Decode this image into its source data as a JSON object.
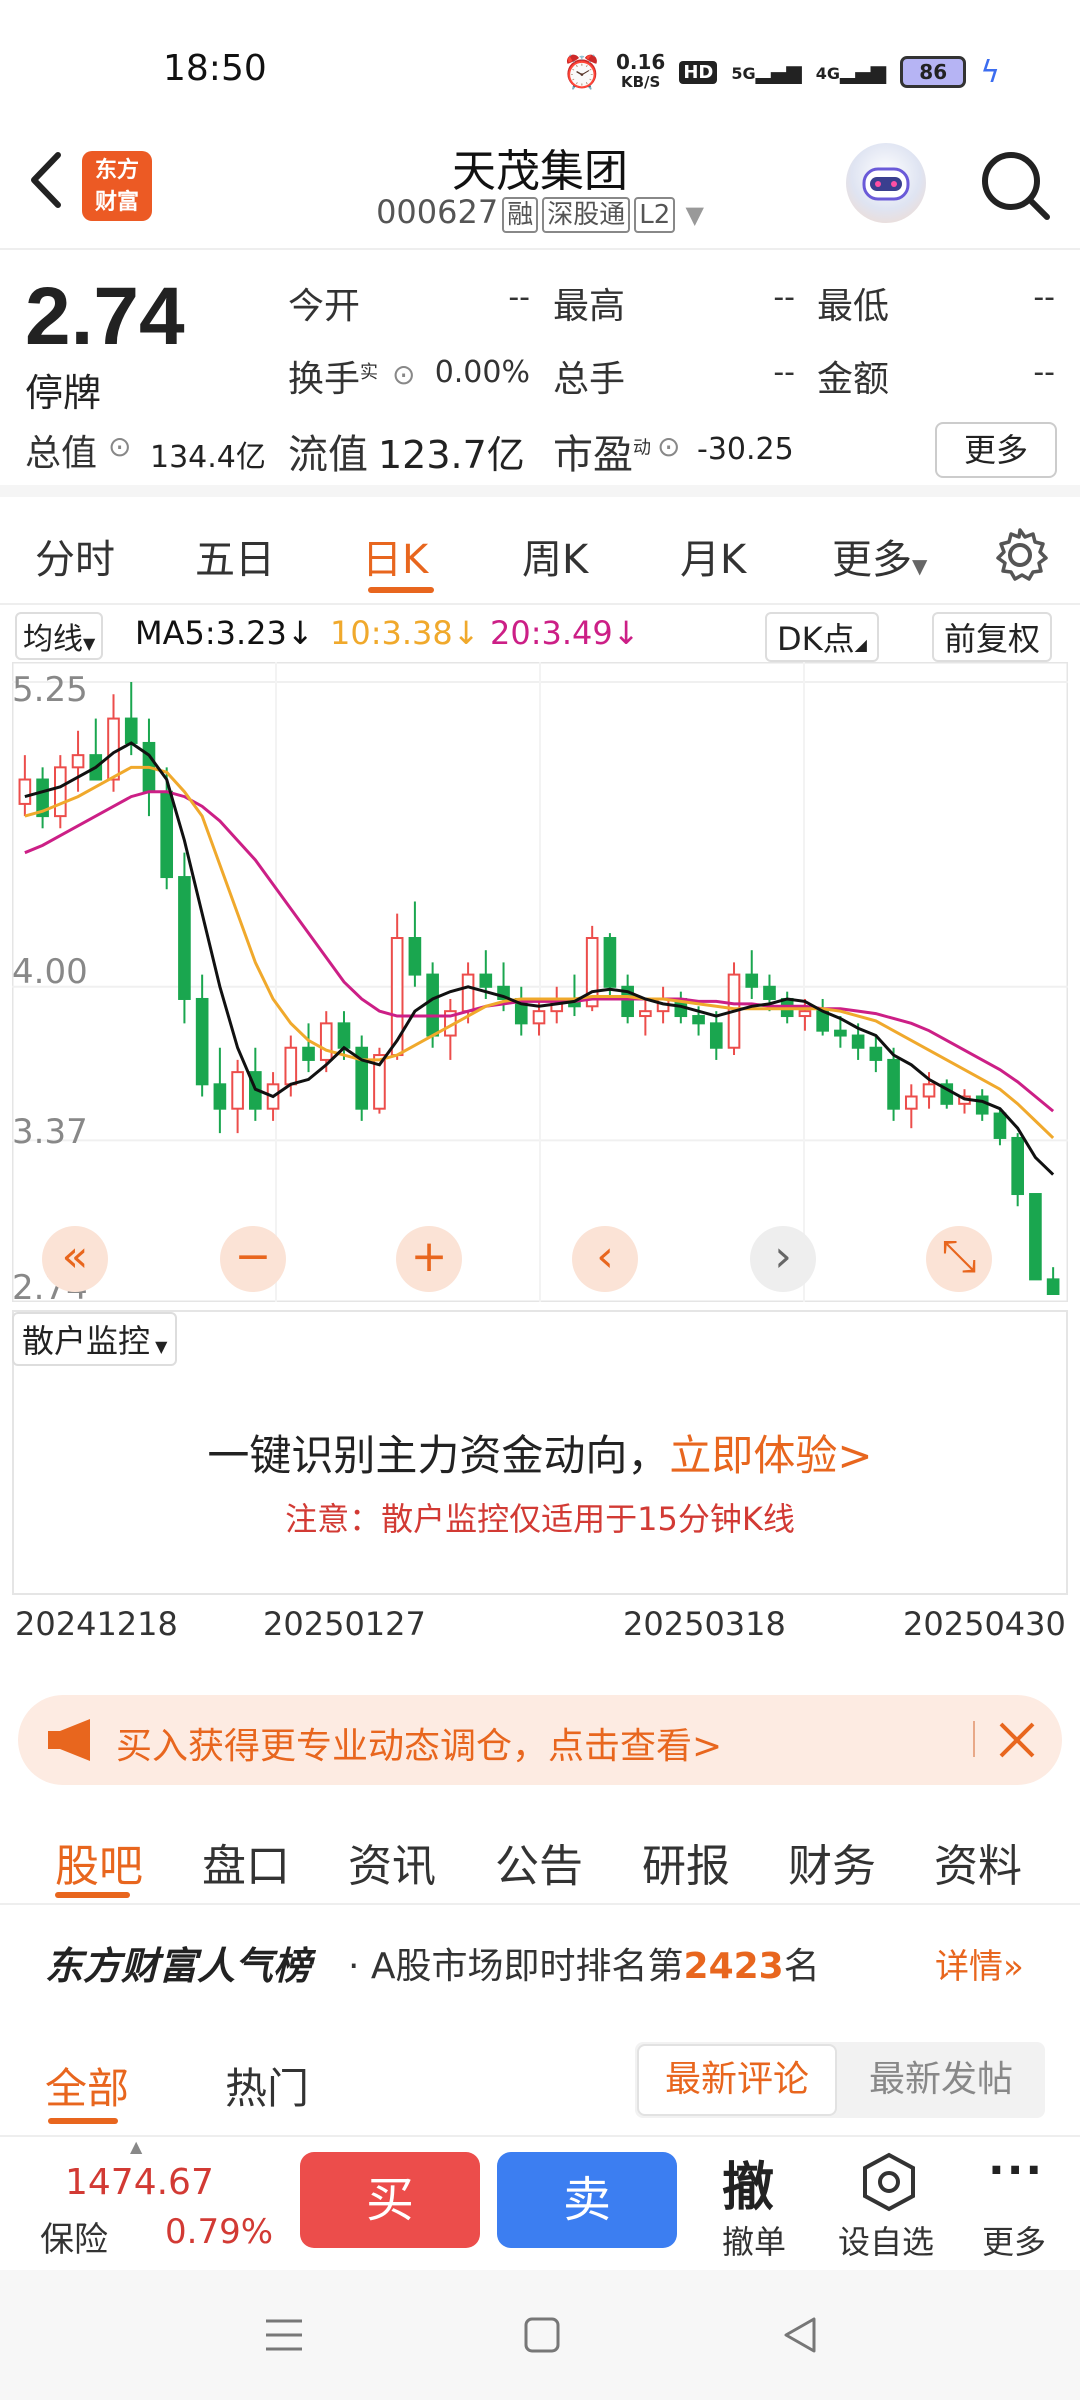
{
  "status": {
    "time": "18:50",
    "net_speed_top": "0.16",
    "net_speed_unit": "KB/S",
    "hd": "HD",
    "sig1": "5G",
    "sig2": "4G",
    "battery": "86"
  },
  "header": {
    "logo_line1": "东方",
    "logo_line2": "财富",
    "title": "天茂集团",
    "code": "000627",
    "tags": [
      "融",
      "深股通",
      "L2"
    ]
  },
  "quote": {
    "price": "2.74",
    "status": "停牌",
    "rows": [
      [
        {
          "label": "今开",
          "value": "--"
        },
        {
          "label": "最高",
          "value": "--"
        },
        {
          "label": "最低",
          "value": "--"
        }
      ],
      [
        {
          "label": "换手",
          "sup": "实",
          "value": "0.00%"
        },
        {
          "label": "总手",
          "value": "--"
        },
        {
          "label": "金额",
          "value": "--"
        }
      ]
    ],
    "total_value_label": "总值",
    "total_value": "134.4亿",
    "float_label": "流值",
    "float_value": "123.7亿",
    "pe_label": "市盈",
    "pe_sup": "动",
    "pe_value": "-30.25",
    "more": "更多"
  },
  "tabs": [
    "分时",
    "五日",
    "日K",
    "周K",
    "月K",
    "更多"
  ],
  "ma": {
    "select": "均线",
    "ma5": "MA5:3.23",
    "ma10": "10:3.38",
    "ma20": "20:3.49",
    "dk": "DK点",
    "adjust": "前复权"
  },
  "colors": {
    "accent": "#e8661e",
    "up": "#ec4d4b",
    "down": "#1aa64f",
    "ma5": "#111111",
    "ma10": "#f0a92c",
    "ma20": "#cc1f86",
    "buy": "#ec4d4b",
    "sell": "#3c7ef1"
  },
  "chart_data": {
    "type": "candlestick",
    "ylim": [
      2.74,
      5.25
    ],
    "y_ticks": [
      "5.25",
      "4.00",
      "3.37",
      "2.74"
    ],
    "x_ticks": [
      "20241218",
      "20250127",
      "20250318",
      "20250430"
    ],
    "candles": [
      [
        4.75,
        4.95,
        4.7,
        4.85
      ],
      [
        4.85,
        4.9,
        4.65,
        4.7
      ],
      [
        4.7,
        4.95,
        4.65,
        4.9
      ],
      [
        4.9,
        5.05,
        4.8,
        4.95
      ],
      [
        4.95,
        5.1,
        4.85,
        4.85
      ],
      [
        4.85,
        5.2,
        4.8,
        5.1
      ],
      [
        5.1,
        5.25,
        4.95,
        5.0
      ],
      [
        5.0,
        5.1,
        4.7,
        4.8
      ],
      [
        4.8,
        4.9,
        4.4,
        4.45
      ],
      [
        4.45,
        4.55,
        3.85,
        3.95
      ],
      [
        3.95,
        4.05,
        3.55,
        3.6
      ],
      [
        3.6,
        3.75,
        3.4,
        3.5
      ],
      [
        3.5,
        3.7,
        3.4,
        3.65
      ],
      [
        3.65,
        3.75,
        3.45,
        3.5
      ],
      [
        3.5,
        3.65,
        3.45,
        3.6
      ],
      [
        3.6,
        3.8,
        3.55,
        3.75
      ],
      [
        3.75,
        3.85,
        3.65,
        3.7
      ],
      [
        3.7,
        3.9,
        3.65,
        3.85
      ],
      [
        3.85,
        3.9,
        3.7,
        3.75
      ],
      [
        3.75,
        3.8,
        3.45,
        3.5
      ],
      [
        3.5,
        3.75,
        3.48,
        3.72
      ],
      [
        3.72,
        4.3,
        3.7,
        4.2
      ],
      [
        4.2,
        4.35,
        4.0,
        4.05
      ],
      [
        4.05,
        4.1,
        3.75,
        3.8
      ],
      [
        3.8,
        3.95,
        3.7,
        3.9
      ],
      [
        3.9,
        4.1,
        3.85,
        4.05
      ],
      [
        4.05,
        4.15,
        3.95,
        4.0
      ],
      [
        4.0,
        4.1,
        3.9,
        3.95
      ],
      [
        3.95,
        4.0,
        3.8,
        3.85
      ],
      [
        3.85,
        3.95,
        3.8,
        3.9
      ],
      [
        3.9,
        4.0,
        3.85,
        3.95
      ],
      [
        3.95,
        4.05,
        3.88,
        3.92
      ],
      [
        3.92,
        4.25,
        3.9,
        4.2
      ],
      [
        4.2,
        4.22,
        3.95,
        4.0
      ],
      [
        4.0,
        4.05,
        3.85,
        3.88
      ],
      [
        3.88,
        3.95,
        3.8,
        3.9
      ],
      [
        3.9,
        4.0,
        3.85,
        3.95
      ],
      [
        3.95,
        3.98,
        3.85,
        3.88
      ],
      [
        3.88,
        3.92,
        3.8,
        3.85
      ],
      [
        3.85,
        3.9,
        3.7,
        3.75
      ],
      [
        3.75,
        4.1,
        3.72,
        4.05
      ],
      [
        4.05,
        4.15,
        3.95,
        4.0
      ],
      [
        4.0,
        4.05,
        3.9,
        3.95
      ],
      [
        3.95,
        3.98,
        3.85,
        3.88
      ],
      [
        3.88,
        3.95,
        3.82,
        3.9
      ],
      [
        3.9,
        3.95,
        3.8,
        3.82
      ],
      [
        3.82,
        3.88,
        3.75,
        3.8
      ],
      [
        3.8,
        3.85,
        3.7,
        3.75
      ],
      [
        3.75,
        3.8,
        3.65,
        3.7
      ],
      [
        3.7,
        3.75,
        3.45,
        3.5
      ],
      [
        3.5,
        3.6,
        3.42,
        3.55
      ],
      [
        3.55,
        3.65,
        3.5,
        3.6
      ],
      [
        3.6,
        3.62,
        3.5,
        3.52
      ],
      [
        3.52,
        3.58,
        3.48,
        3.55
      ],
      [
        3.55,
        3.58,
        3.45,
        3.48
      ],
      [
        3.48,
        3.5,
        3.35,
        3.38
      ],
      [
        3.38,
        3.4,
        3.1,
        3.15
      ],
      [
        3.15,
        3.15,
        2.8,
        2.8
      ],
      [
        2.8,
        2.85,
        2.74,
        2.74
      ]
    ],
    "ma5": [
      4.78,
      4.8,
      4.82,
      4.86,
      4.9,
      4.96,
      5.0,
      4.95,
      4.85,
      4.6,
      4.3,
      4.0,
      3.75,
      3.58,
      3.55,
      3.6,
      3.62,
      3.68,
      3.75,
      3.7,
      3.68,
      3.78,
      3.9,
      3.95,
      3.98,
      4.0,
      3.98,
      3.96,
      3.93,
      3.92,
      3.93,
      3.94,
      3.98,
      3.99,
      3.98,
      3.95,
      3.93,
      3.92,
      3.9,
      3.88,
      3.9,
      3.92,
      3.93,
      3.95,
      3.94,
      3.9,
      3.87,
      3.83,
      3.8,
      3.72,
      3.68,
      3.62,
      3.58,
      3.54,
      3.53,
      3.5,
      3.42,
      3.3,
      3.23
    ],
    "ma10": [
      4.7,
      4.72,
      4.75,
      4.78,
      4.82,
      4.86,
      4.9,
      4.9,
      4.88,
      4.8,
      4.7,
      4.5,
      4.3,
      4.1,
      3.95,
      3.85,
      3.78,
      3.74,
      3.72,
      3.7,
      3.7,
      3.72,
      3.76,
      3.8,
      3.84,
      3.88,
      3.92,
      3.94,
      3.95,
      3.95,
      3.95,
      3.95,
      3.96,
      3.96,
      3.96,
      3.95,
      3.95,
      3.94,
      3.93,
      3.92,
      3.91,
      3.91,
      3.91,
      3.91,
      3.91,
      3.91,
      3.9,
      3.88,
      3.86,
      3.82,
      3.78,
      3.74,
      3.7,
      3.66,
      3.62,
      3.58,
      3.52,
      3.45,
      3.38
    ],
    "ma20": [
      4.55,
      4.58,
      4.62,
      4.66,
      4.7,
      4.74,
      4.78,
      4.8,
      4.8,
      4.78,
      4.74,
      4.68,
      4.6,
      4.52,
      4.42,
      4.32,
      4.22,
      4.12,
      4.02,
      3.95,
      3.9,
      3.88,
      3.88,
      3.88,
      3.88,
      3.9,
      3.92,
      3.93,
      3.94,
      3.94,
      3.94,
      3.94,
      3.95,
      3.95,
      3.95,
      3.95,
      3.95,
      3.95,
      3.94,
      3.94,
      3.93,
      3.93,
      3.92,
      3.92,
      3.92,
      3.91,
      3.91,
      3.9,
      3.89,
      3.87,
      3.85,
      3.82,
      3.78,
      3.74,
      3.7,
      3.66,
      3.61,
      3.55,
      3.49
    ]
  },
  "chart_toolbar": [
    "«",
    "−",
    "+",
    "‹",
    "›",
    "⤡"
  ],
  "monitor": {
    "select": "散户监控",
    "headline": "一键识别主力资金动向，",
    "cta": "立即体验>",
    "note": "注意：散户监控仅适用于15分钟K线"
  },
  "promo": {
    "text": "买入获得更专业动态调仓，点击查看>"
  },
  "sub_tabs": [
    "股吧",
    "盘口",
    "资讯",
    "公告",
    "研报",
    "财务",
    "资料"
  ],
  "rank": {
    "brand": "东方财富人气榜",
    "text_pre": "· A股市场即时排名第",
    "rank": "2423",
    "text_post": "名",
    "detail": "详情"
  },
  "comment_tabs": {
    "all": "全部",
    "hot": "热门",
    "latest_comment": "最新评论",
    "latest_post": "最新发帖"
  },
  "bottom": {
    "index_value": "1474.67",
    "index_name": "保险",
    "index_change": "0.79%",
    "buy": "买",
    "sell": "卖",
    "cancel_icon": "撤",
    "cancel": "撤单",
    "watch": "设自选",
    "more": "更多"
  }
}
